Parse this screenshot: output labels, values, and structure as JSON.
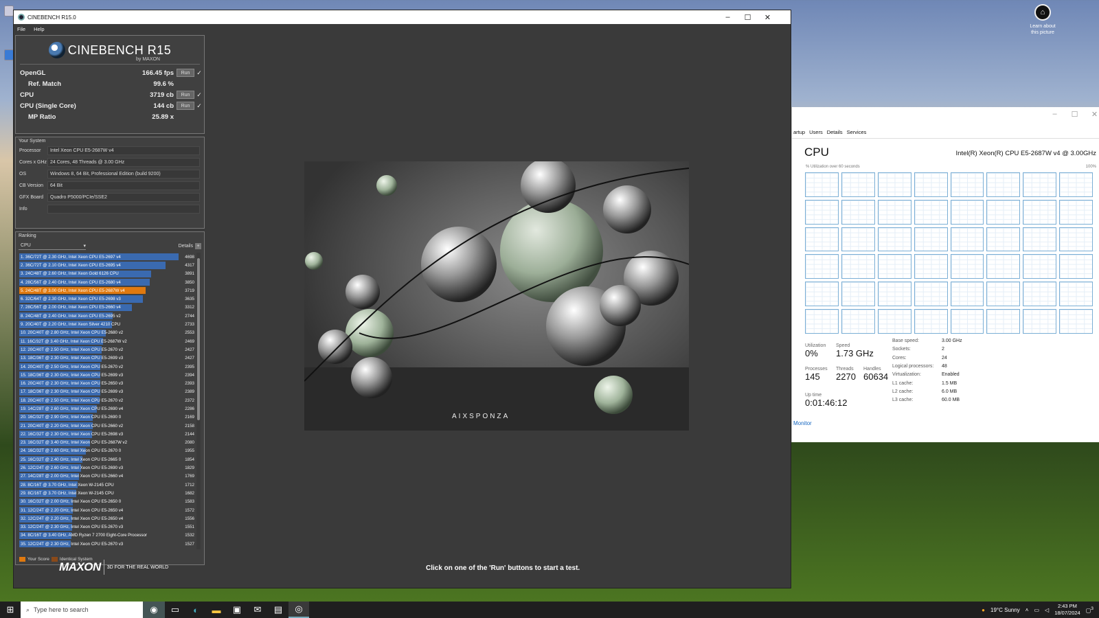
{
  "desktop": {
    "learn_line1": "Learn about",
    "learn_line2": "this picture"
  },
  "cinebench": {
    "title": "CINEBENCH R15.0",
    "menu": [
      "File",
      "Help"
    ],
    "logo": {
      "name": "CINEBENCH R15",
      "by": "by MAXON"
    },
    "scores": {
      "opengl": {
        "label": "OpenGL",
        "value": "166.45 fps",
        "run": "Run"
      },
      "refmatch": {
        "label": "Ref. Match",
        "value": "99.6 %"
      },
      "cpu": {
        "label": "CPU",
        "value": "3719 cb",
        "run": "Run"
      },
      "cpu_single": {
        "label": "CPU (Single Core)",
        "value": "144 cb",
        "run": "Run"
      },
      "mp_ratio": {
        "label": "MP Ratio",
        "value": "25.89 x"
      }
    },
    "system": {
      "title": "Your System",
      "rows": [
        {
          "k": "Processor",
          "v": "Intel Xeon CPU E5-2687W v4"
        },
        {
          "k": "Cores x GHz",
          "v": "24 Cores, 48 Threads @ 3.00 GHz"
        },
        {
          "k": "OS",
          "v": "Windows 8, 64 Bit, Professional Edition (build 9200)"
        },
        {
          "k": "CB Version",
          "v": "64 Bit"
        },
        {
          "k": "GFX Board",
          "v": "Quadro P5000/PCIe/SSE2"
        },
        {
          "k": "Info",
          "v": ""
        }
      ]
    },
    "ranking": {
      "title": "Ranking",
      "select": "CPU",
      "details": "Details",
      "max": 4698,
      "rows": [
        {
          "name": "1. 36C/72T @ 2.30 GHz, Intel Xeon CPU E5-2697 v4",
          "score": 4698
        },
        {
          "name": "2. 36C/72T @ 2.10 GHz, Intel Xeon CPU E5-2695 v4",
          "score": 4317
        },
        {
          "name": "3. 24C/48T @ 2.60 GHz, Intel Xeon Gold 6126 CPU",
          "score": 3891
        },
        {
          "name": "4. 28C/56T @ 2.40 GHz, Intel Xeon CPU E5-2680 v4",
          "score": 3850
        },
        {
          "name": "5. 24C/48T @ 3.00 GHz, Intel Xeon CPU E5-2687W v4",
          "score": 3719,
          "highlight": true
        },
        {
          "name": "6. 32C/64T @ 2.30 GHz, Intel Xeon CPU E5-2698 v3",
          "score": 3635
        },
        {
          "name": "7. 28C/56T @ 2.00 GHz, Intel Xeon CPU E5-2660 v4",
          "score": 3312
        },
        {
          "name": "8. 24C/48T @ 2.40 GHz,  Intel Xeon CPU E5-2695 v2",
          "score": 2744
        },
        {
          "name": "9. 20C/40T @ 2.20 GHz, Intel Xeon Silver 4210 CPU",
          "score": 2733
        },
        {
          "name": "10. 20C/40T @ 2.80 GHz,  Intel Xeon CPU E5-2680 v2",
          "score": 2553
        },
        {
          "name": "11. 16C/32T @ 3.40 GHz,  Intel Xeon CPU E5-2687W v2",
          "score": 2469
        },
        {
          "name": "12. 20C/40T @ 2.50 GHz,  Intel Xeon CPU E5-2670 v2",
          "score": 2427
        },
        {
          "name": "13. 18C/36T @ 2.30 GHz, Intel Xeon CPU E5-2699 v3",
          "score": 2427
        },
        {
          "name": "14. 20C/40T @ 2.50 GHz,  Intel Xeon CPU E5-2670 v2",
          "score": 2395
        },
        {
          "name": "15. 18C/36T @ 2.30 GHz, Intel Xeon CPU E5-2699 v3",
          "score": 2394
        },
        {
          "name": "16. 20C/40T @ 2.30 GHz, Intel Xeon CPU E5-2650 v3",
          "score": 2393
        },
        {
          "name": "17. 18C/36T @ 2.30 GHz, Intel Xeon CPU E5-2699 v3",
          "score": 2389
        },
        {
          "name": "18. 20C/40T @ 2.50 GHz,  Intel Xeon CPU E5-2670 v2",
          "score": 2372
        },
        {
          "name": "19. 14C/28T @ 2.60 GHz, Intel Xeon CPU E5-2690 v4",
          "score": 2286
        },
        {
          "name": "20. 16C/32T @ 2.90 GHz,  Intel Xeon CPU E5-2690 0",
          "score": 2169
        },
        {
          "name": "21. 20C/40T @ 2.20 GHz,  Intel Xeon CPU E5-2660 v2",
          "score": 2158
        },
        {
          "name": "22. 16C/32T @ 2.30 GHz, Intel Xeon CPU E5-2698 v3",
          "score": 2144
        },
        {
          "name": "23. 16C/32T @ 3.40 GHz,  Intel Xeon CPU E5-2687W v2",
          "score": 2080
        },
        {
          "name": "24. 16C/32T @ 2.60 GHz,  Intel Xeon CPU E5-2670 0",
          "score": 1955
        },
        {
          "name": "25. 16C/32T @ 2.40 GHz,  Intel Xeon CPU E5-2665 0",
          "score": 1854
        },
        {
          "name": "26. 12C/24T @ 2.60 GHz, Intel Xeon CPU E5-2690 v3",
          "score": 1829
        },
        {
          "name": "27. 14C/28T @ 2.00 GHz, Intel Xeon CPU E5-2660 v4",
          "score": 1769
        },
        {
          "name": "28. 8C/16T @ 3.70 GHz, Intel Xeon W-2145 CPU",
          "score": 1712
        },
        {
          "name": "29. 8C/16T @ 3.70 GHz, Intel Xeon W-2145 CPU",
          "score": 1682
        },
        {
          "name": "30. 16C/32T @ 2.00 GHz, Intel Xeon CPU E5-2650 0",
          "score": 1583
        },
        {
          "name": "31. 12C/24T @ 2.20 GHz, Intel Xeon CPU E5-2650 v4",
          "score": 1572
        },
        {
          "name": "32. 12C/24T @ 2.20 GHz, Intel Xeon CPU E5-2650 v4",
          "score": 1556
        },
        {
          "name": "33. 12C/24T @ 2.30 GHz, Intel Xeon CPU E5-2670 v3",
          "score": 1551
        },
        {
          "name": "34. 8C/16T @ 3.40 GHz, AMD Ryzen 7 2700 Eight-Core Processor",
          "score": 1532
        },
        {
          "name": "35. 12C/24T @ 2.30 GHz, Intel Xeon CPU E5-2670 v3",
          "score": 1527
        }
      ],
      "legend_your": "Your Score",
      "legend_identical": "Identical System"
    },
    "footer": {
      "brand": "MAXON",
      "tagline": "3D FOR THE REAL WORLD",
      "status": "Click on one of the 'Run' buttons to start a test."
    },
    "render_watermark": "AIXSPONZA",
    "colors": {
      "bar": "#3a6ab0",
      "highlight": "#e0790f",
      "identical": "#8a4a1a"
    }
  },
  "taskmgr": {
    "tabs": [
      "artup",
      "Users",
      "Details",
      "Services"
    ],
    "title": "CPU",
    "cpu_name": "Intel(R) Xeon(R) CPU E5-2687W v4 @ 3.00GHz",
    "graph_label": "% Utilization over 60 seconds",
    "graph_max": "100%",
    "utilization": {
      "k": "Utilization",
      "v": "0%"
    },
    "speed": {
      "k": "Speed",
      "v": "1.73 GHz"
    },
    "processes": {
      "k": "Processes",
      "v": "145"
    },
    "threads": {
      "k": "Threads",
      "v": "2270"
    },
    "handles": {
      "k": "Handles",
      "v": "60634"
    },
    "uptime": {
      "k": "Up time",
      "v": "0:01:46:12"
    },
    "specs": [
      {
        "k": "Base speed:",
        "v": "3.00 GHz"
      },
      {
        "k": "Sockets:",
        "v": "2"
      },
      {
        "k": "Cores:",
        "v": "24"
      },
      {
        "k": "Logical processors:",
        "v": "48"
      },
      {
        "k": "Virtualization:",
        "v": "Enabled"
      },
      {
        "k": "L1 cache:",
        "v": "1.5 MB"
      },
      {
        "k": "L2 cache:",
        "v": "6.0 MB"
      },
      {
        "k": "L3 cache:",
        "v": "60.0 MB"
      }
    ],
    "monitor_link": "Monitor"
  },
  "taskbar": {
    "search_placeholder": "Type here to search",
    "weather": "19°C  Sunny",
    "time": "2:43 PM",
    "date": "18/07/2024",
    "notif_count": "3"
  }
}
